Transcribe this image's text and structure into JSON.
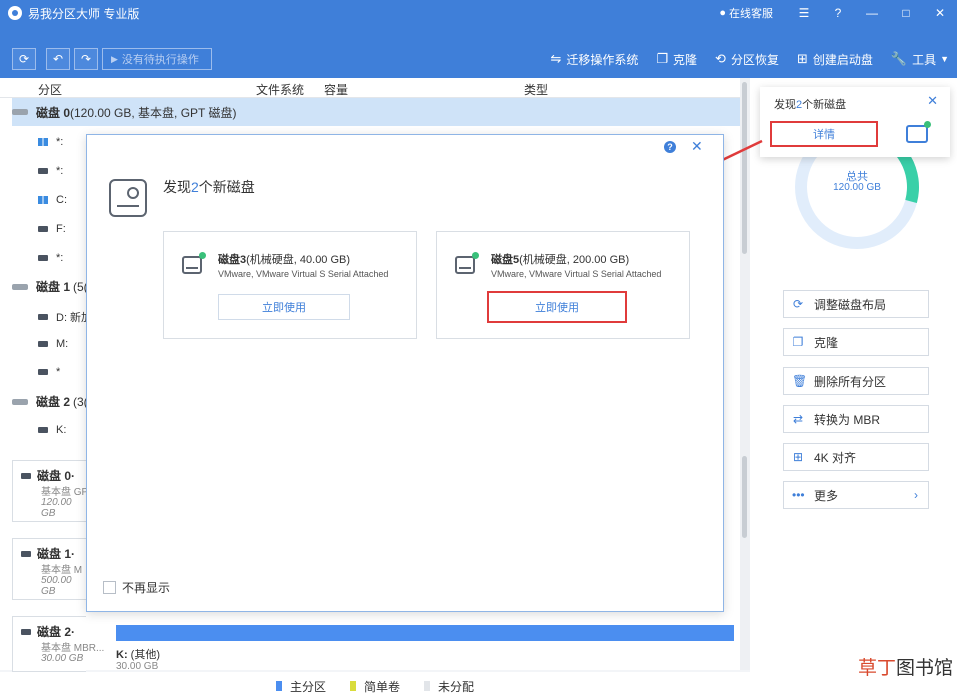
{
  "titlebar": {
    "title": "易我分区大师 专业版",
    "support": "在线客服",
    "menu_glyph": "☰",
    "help_glyph": "?",
    "min_glyph": "—",
    "max_glyph": "□",
    "close_glyph": "✕"
  },
  "toolbar": {
    "refresh_glyph": "⟳",
    "undo_glyph": "↶",
    "redo_glyph": "↷",
    "pending": "没有待执行操作",
    "actions": [
      {
        "label": "迁移操作系统",
        "icon": "migrate-icon"
      },
      {
        "label": "克隆",
        "icon": "clone-icon"
      },
      {
        "label": "分区恢复",
        "icon": "recovery-icon"
      },
      {
        "label": "创建启动盘",
        "icon": "windows-icon"
      },
      {
        "label": "工具",
        "icon": "wrench-icon"
      }
    ]
  },
  "table": {
    "headers": [
      "分区",
      "文件系统",
      "容量",
      "类型"
    ]
  },
  "disks": [
    {
      "name": "磁盘 0",
      "detail": "(120.00 GB, 基本盘, GPT 磁盘)"
    },
    {
      "name": "磁盘 1",
      "detail": "(5("
    },
    {
      "name": "磁盘 2",
      "detail": "(3("
    }
  ],
  "partitions": {
    "disk0": [
      "*:",
      "*:",
      "C:",
      "F:",
      "*:"
    ],
    "disk1": [
      "D: 新加",
      "M:",
      "*"
    ],
    "disk2": [
      "K:"
    ]
  },
  "disk_cards": [
    {
      "name": "磁盘 0·",
      "type": "基本盘 GP",
      "size": "120.00 GB"
    },
    {
      "name": "磁盘 1·",
      "type": "基本盘 M",
      "size": "500.00 GB"
    },
    {
      "name": "磁盘 2·",
      "type": "基本盘 MBR...",
      "size": "30.00 GB"
    }
  ],
  "disk2_bar": {
    "label": "K:",
    "label_extra": "(其他)",
    "size": "30.00 GB"
  },
  "legend": [
    {
      "label": "主分区",
      "color": "#4b8ef0"
    },
    {
      "label": "简单卷",
      "color": "#d9dc3c"
    },
    {
      "label": "未分配",
      "color": "#e2e5e9"
    }
  ],
  "notice": {
    "prefix": "发现",
    "count": "2",
    "suffix": "个新磁盘",
    "details": "详情",
    "close_glyph": "✕"
  },
  "ring": {
    "total_label": "总共",
    "total_size": "120.00 GB"
  },
  "side_actions": [
    {
      "label": "调整磁盘布局",
      "icon": "⟳"
    },
    {
      "label": "克隆",
      "icon": "❐"
    },
    {
      "label": "删除所有分区",
      "icon": "🗑"
    },
    {
      "label": "转换为 MBR",
      "icon": "⇄"
    },
    {
      "label": "4K 对齐",
      "icon": "⊞"
    },
    {
      "label": "更多",
      "icon": "•••",
      "chevron": "›"
    }
  ],
  "modal": {
    "title_prefix": "发现",
    "title_count": "2",
    "title_suffix": "个新磁盘",
    "help_glyph": "?",
    "close_glyph": "✕",
    "cards": [
      {
        "name": "磁盘3",
        "spec": "(机械硬盘, 40.00 GB)",
        "vendor": "VMware,  VMware Virtual S Serial Attached",
        "button": "立即使用"
      },
      {
        "name": "磁盘5",
        "spec": "(机械硬盘, 200.00 GB)",
        "vendor": "VMware,  VMware Virtual S Serial Attached",
        "button": "立即使用"
      }
    ],
    "dont_show": "不再显示"
  },
  "watermark": {
    "part1": "草丁",
    "part2": "图书馆"
  }
}
